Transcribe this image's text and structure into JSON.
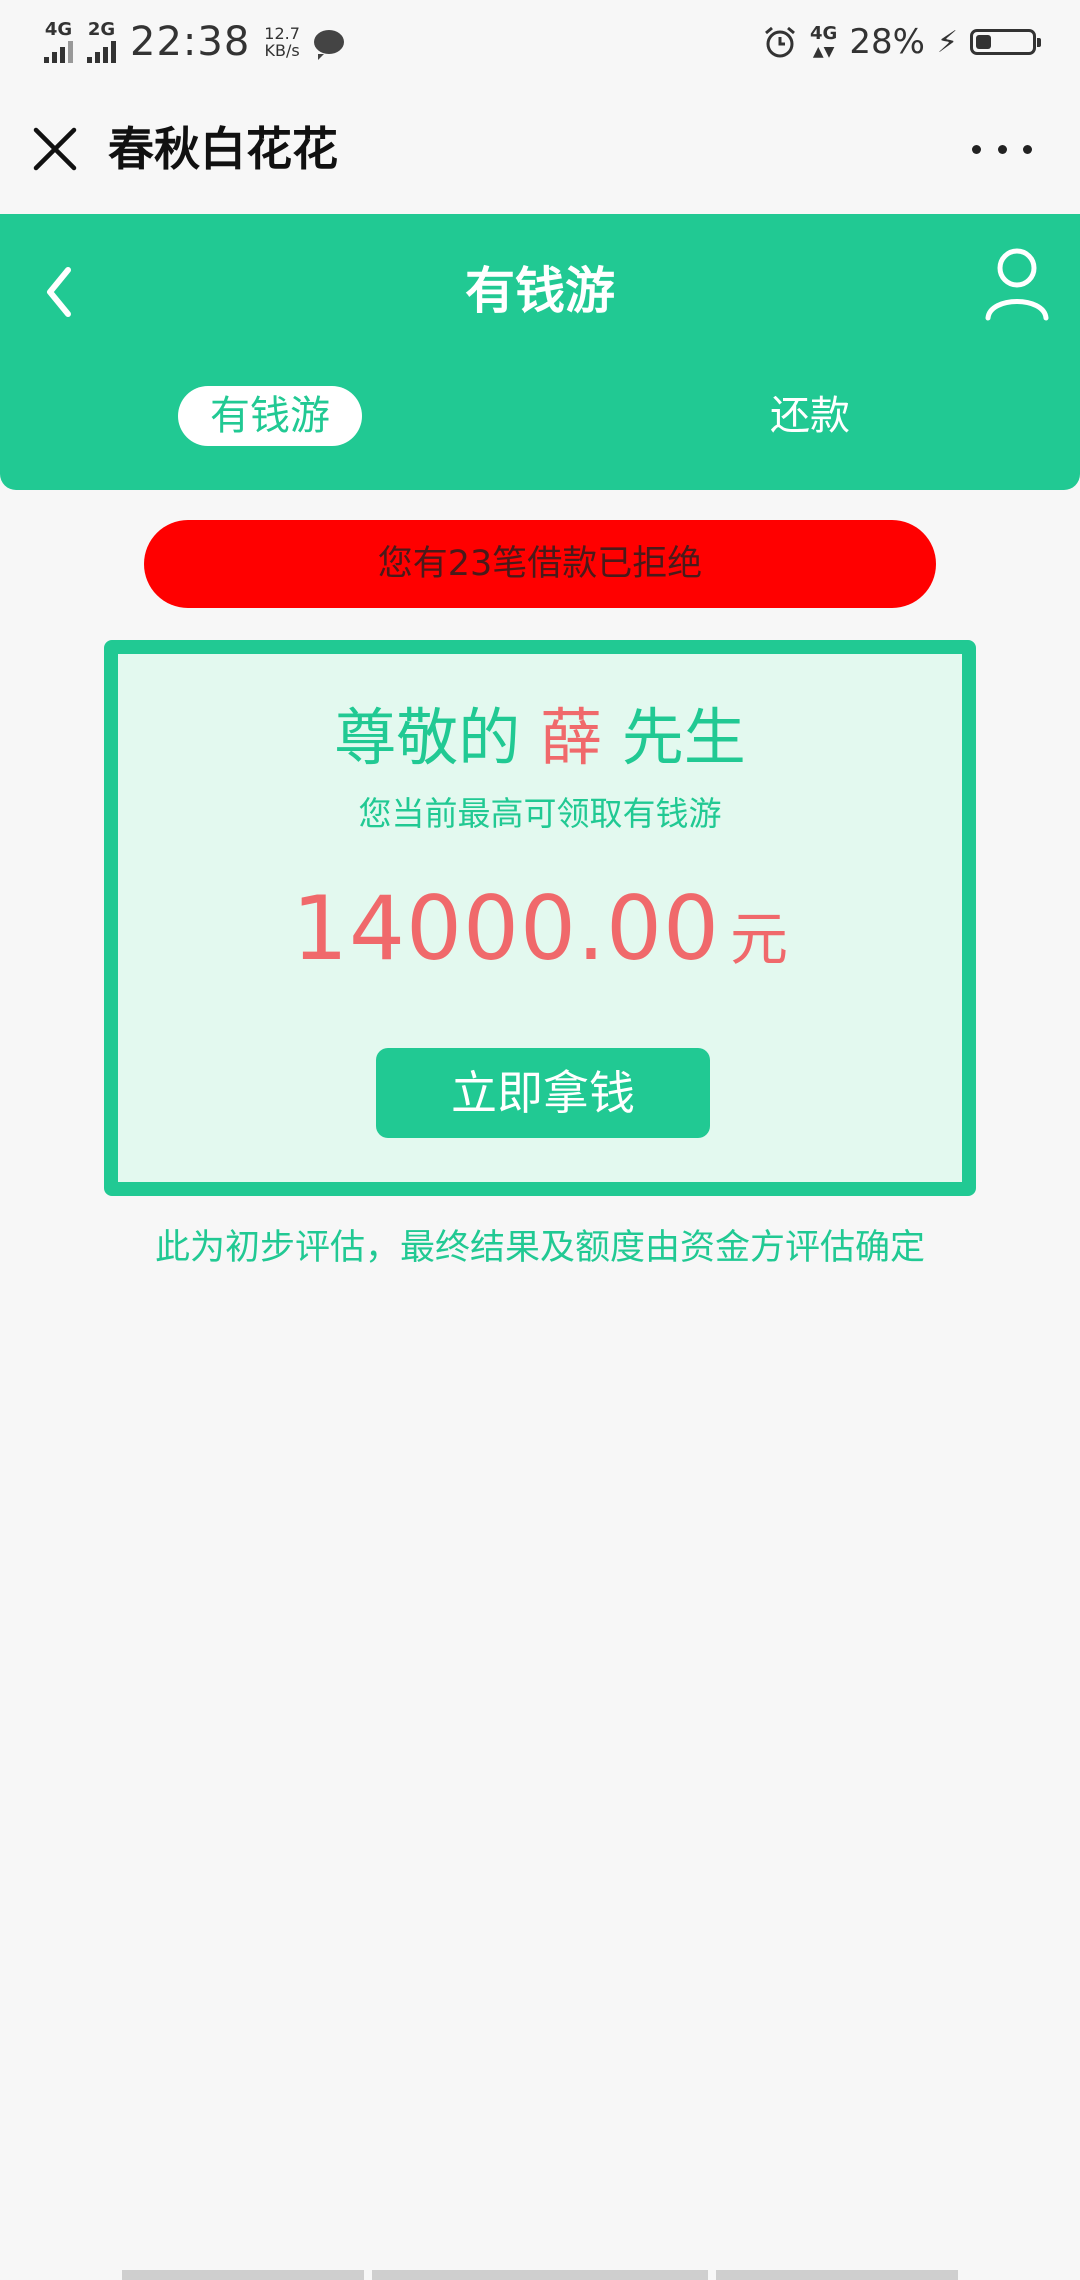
{
  "status_bar": {
    "signal1": "4G",
    "signal2": "2G",
    "time": "22:38",
    "speed_value": "12.7",
    "speed_unit": "KB/s",
    "network_right": "4G",
    "battery_text": "28%",
    "battery_level": 0.28
  },
  "top_bar": {
    "title": "春秋白花花"
  },
  "header": {
    "title": "有钱游",
    "tabs": [
      {
        "label": "有钱游",
        "active": true
      },
      {
        "label": "还款",
        "active": false
      }
    ]
  },
  "notice": {
    "text": "您有23笔借款已拒绝"
  },
  "card": {
    "greeting_prefix": "尊敬的",
    "surname": "薛",
    "greeting_suffix": "先生",
    "subtitle": "您当前最高可领取有钱游",
    "amount": "14000.00",
    "currency": "元",
    "button_label": "立即拿钱"
  },
  "disclaimer": "此为初步评估，最终结果及额度由资金方评估确定",
  "colors": {
    "primary": "#21c993",
    "notice_red": "#ff0000",
    "amount_red": "#f0696b",
    "card_bg": "#e3f9ef",
    "page_bg": "#f7f7f7"
  }
}
